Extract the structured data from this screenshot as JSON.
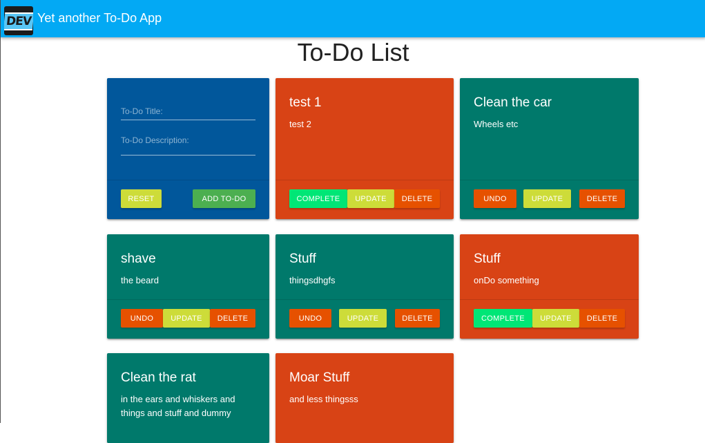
{
  "app": {
    "title": "Yet another To-Do App",
    "logo_text": "DEV"
  },
  "page": {
    "heading": "To-Do List"
  },
  "form": {
    "title_placeholder": "To-Do Title:",
    "description_placeholder": "To-Do Description:",
    "reset_label": "RESET",
    "add_label": "ADD TO-DO"
  },
  "labels": {
    "complete": "COMPLETE",
    "update": "UPDATE",
    "delete": "DELETE",
    "undo": "UNDO"
  },
  "todos": [
    {
      "title": "test 1",
      "description": "test 2",
      "completed": false
    },
    {
      "title": "Clean the car",
      "description": "Wheels etc",
      "completed": true
    },
    {
      "title": "shave",
      "description": "the beard",
      "completed": true
    },
    {
      "title": "Stuff",
      "description": "thingsdhgfs",
      "completed": true
    },
    {
      "title": "Stuff",
      "description": "onDo something",
      "completed": false
    },
    {
      "title": "Clean the rat",
      "description": "in the ears and whiskers and things and stuff and dummy",
      "completed": true
    },
    {
      "title": "Moar Stuff",
      "description": "and less thingsss",
      "completed": false
    }
  ],
  "colors": {
    "appbar": "#03a9f4",
    "form_card": "#01579b",
    "completed_card": "#00796b",
    "pending_card": "#d84315",
    "complete_button": "#00e676",
    "update_button": "#cddc39",
    "delete_button": "#e65100",
    "add_button": "#4caf50"
  }
}
